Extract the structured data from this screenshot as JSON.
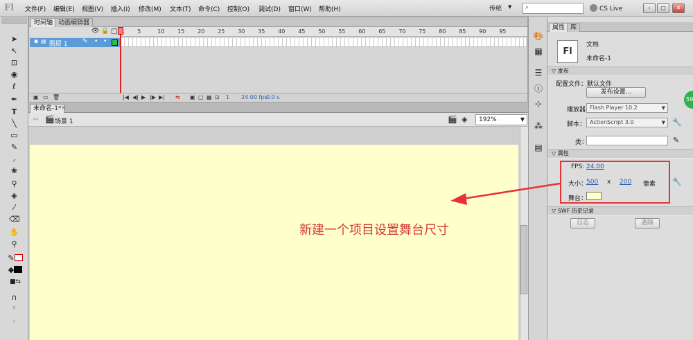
{
  "app": {
    "logo": "Fl"
  },
  "menu": [
    "文件(F)",
    "编辑(E)",
    "视图(V)",
    "插入(I)",
    "修改(M)",
    "文本(T)",
    "命令(C)",
    "控制(O)",
    "调试(D)",
    "窗口(W)",
    "帮助(H)"
  ],
  "workspace": "传统",
  "cs_live": "CS Live",
  "window_buttons": [
    "–",
    "□",
    "✕"
  ],
  "timeline": {
    "tabs": [
      "时间轴",
      "动画编辑器"
    ],
    "frame_numbers": [
      "1",
      "5",
      "10",
      "15",
      "20",
      "25",
      "30",
      "35",
      "40",
      "45",
      "50",
      "55",
      "60",
      "65",
      "70",
      "75",
      "80",
      "85",
      "90",
      "95"
    ],
    "layer_name": "图层 1",
    "current_frame": "1",
    "fps": "24.00 fps",
    "elapsed": "0.0 s"
  },
  "document": {
    "tab": "未命名-1*",
    "close": "×",
    "scene": "场景 1",
    "zoom": "192%"
  },
  "properties": {
    "tabs": [
      "属性",
      "库"
    ],
    "doc_type": "文档",
    "doc_name": "未命名-1",
    "sections": {
      "publish": "发布",
      "props": "属性",
      "swf_history": "SWF 历史记录"
    },
    "profile_label": "配置文件：默认文件",
    "publish_settings": "发布设置...",
    "player_label": "播放器：",
    "player_value": "Flash Player 10.2",
    "script_label": "脚本：",
    "script_value": "ActionScript 3.0",
    "class_label": "类：",
    "fps_label": "FPS:",
    "fps_value": "24.00",
    "size_label": "大小：",
    "width": "500",
    "x": "x",
    "height": "200",
    "unit": "像素",
    "stage_label": "舞台：",
    "stage_color": "#ffffcc",
    "log_button": "日志",
    "clear_button": "清除"
  },
  "annotation": {
    "text": "新建一个项目设置舞台尺寸",
    "color": "#e53333"
  },
  "badge": "59"
}
